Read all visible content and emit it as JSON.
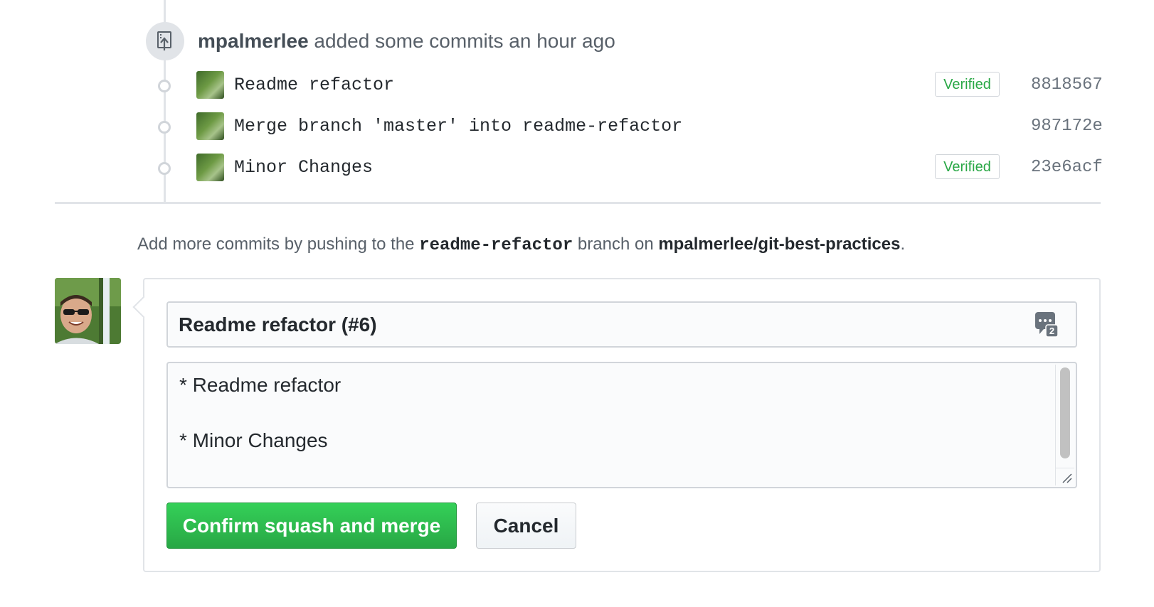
{
  "event": {
    "author": "mpalmerlee",
    "action_text": "added some commits an hour ago",
    "icon": "repo-push-icon"
  },
  "commits": [
    {
      "message": "Readme refactor",
      "verified": "Verified",
      "sha": "8818567"
    },
    {
      "message": "Merge branch 'master' into readme-refactor",
      "verified": "",
      "sha": "987172e"
    },
    {
      "message": "Minor Changes",
      "verified": "Verified",
      "sha": "23e6acf"
    }
  ],
  "push_hint": {
    "prefix": "Add more commits by pushing to the",
    "branch": "readme-refactor",
    "middle": "branch on",
    "repo": "mpalmerlee/git-best-practices",
    "suffix": "."
  },
  "merge_form": {
    "title_value": "Readme refactor (#6)",
    "emoji_icon": "emoji-counter-icon",
    "emoji_count": "2",
    "body_lines": [
      "* Readme refactor",
      "* Minor Changes"
    ],
    "confirm_label": "Confirm squash and merge",
    "cancel_label": "Cancel"
  },
  "colors": {
    "confirm_green": "#28a745",
    "verified_green": "#28a745",
    "timeline_gray": "#e1e4e8"
  }
}
